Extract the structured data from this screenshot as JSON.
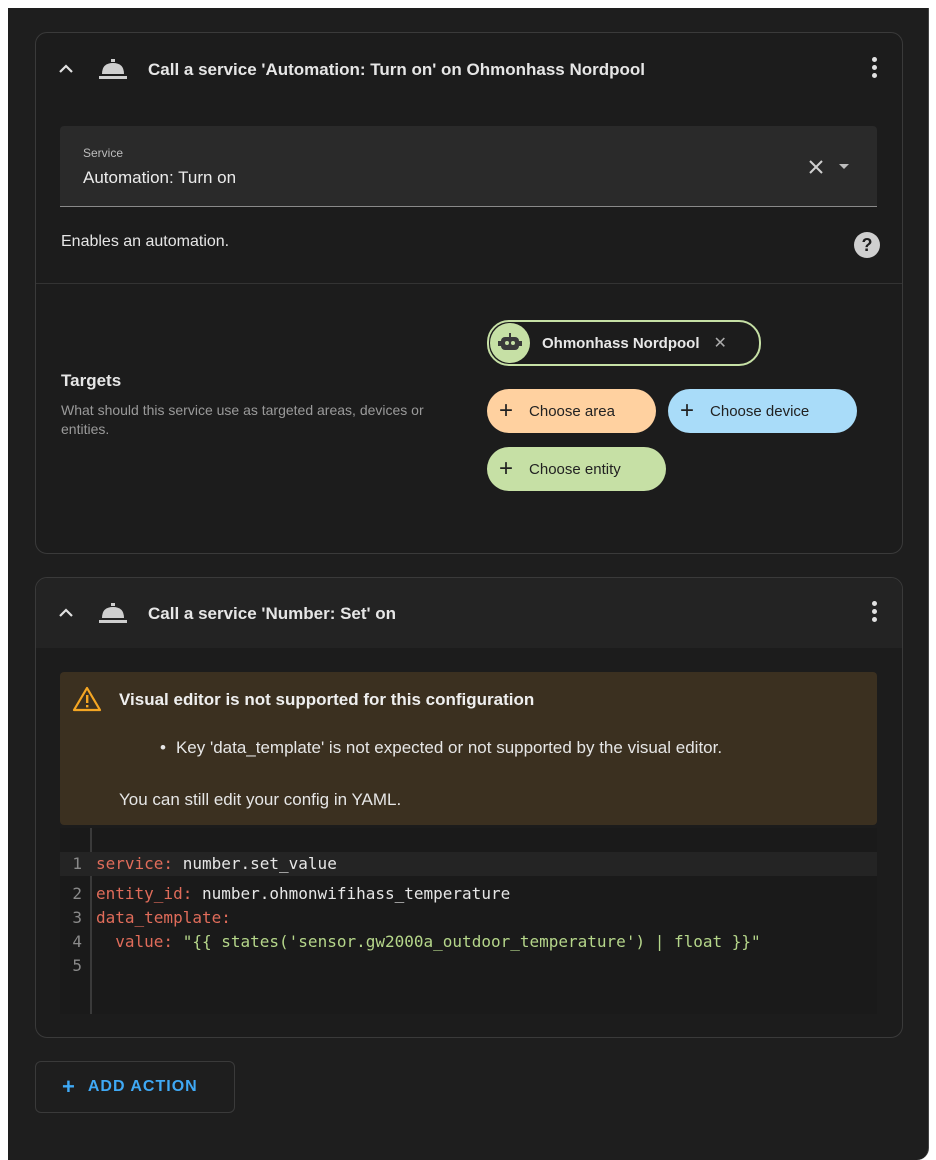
{
  "actions": [
    {
      "title": "Call a service 'Automation: Turn on' on Ohmonhass Nordpool",
      "service_label": "Service",
      "service_value": "Automation: Turn on",
      "description": "Enables an automation.",
      "help_icon": "?",
      "targets_title": "Targets",
      "targets_desc": "What should this service use as targeted areas, devices or entities.",
      "entity_chip": "Ohmonhass Nordpool",
      "chips": {
        "area": "Choose area",
        "device": "Choose device",
        "entity": "Choose entity"
      },
      "colors": {
        "area": "#ffd1a0",
        "device": "#a9dcf9",
        "entity": "#c6e0a5"
      }
    },
    {
      "title": "Call a service 'Number: Set' on",
      "warning_title": "Visual editor is not supported for this configuration",
      "warning_bullet": "Key 'data_template' is not expected or not supported by the visual editor.",
      "warning_note": "You can still edit your config in YAML.",
      "yaml_lines": [
        {
          "n": "1",
          "key": "service:",
          "val": " number.set_value",
          "str": ""
        },
        {
          "n": "2",
          "key": "entity_id:",
          "val": " number.ohmonwifihass_temperature",
          "str": ""
        },
        {
          "n": "3",
          "key": "data_template:",
          "val": "",
          "str": ""
        },
        {
          "n": "4",
          "key": "  value:",
          "val": " ",
          "str": "\"{{ states('sensor.gw2000a_outdoor_temperature') | float }}\""
        },
        {
          "n": "5",
          "key": "",
          "val": "",
          "str": ""
        }
      ]
    }
  ],
  "add_action_label": "ADD ACTION",
  "accent_color": "#3fa9f5"
}
